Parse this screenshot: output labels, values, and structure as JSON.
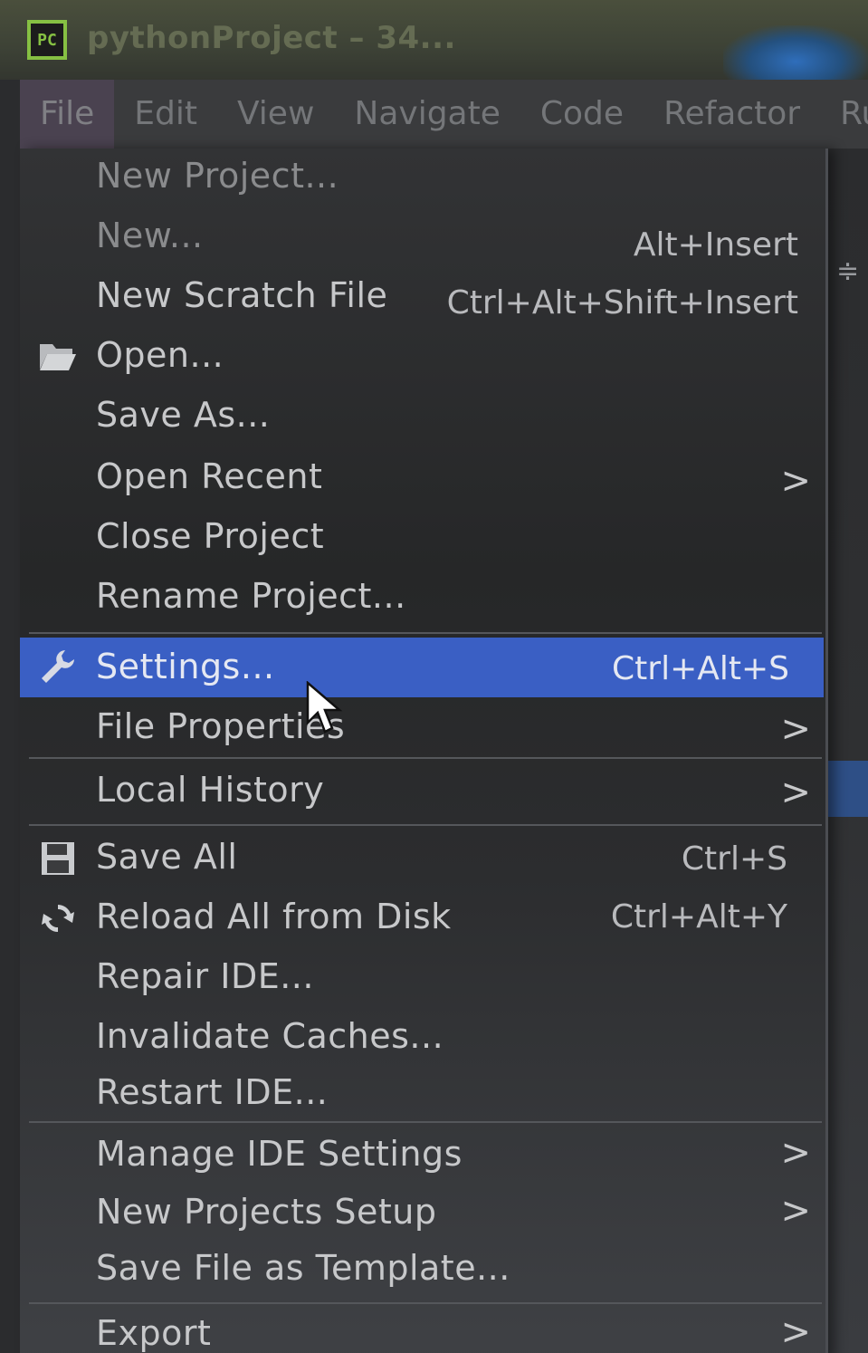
{
  "window": {
    "app_icon_text": "PC",
    "title": "pythonProject – 34..."
  },
  "menubar": {
    "items": [
      {
        "label": "File",
        "active": true
      },
      {
        "label": "Edit"
      },
      {
        "label": "View"
      },
      {
        "label": "Navigate"
      },
      {
        "label": "Code"
      },
      {
        "label": "Refactor"
      },
      {
        "label": "Run"
      }
    ]
  },
  "file_menu": {
    "items": [
      {
        "label": "New Project...",
        "shortcut": "",
        "submenu": false,
        "icon": "",
        "dim": true
      },
      {
        "label": "New...",
        "shortcut": "Alt+Insert",
        "submenu": false,
        "icon": "",
        "dim": true
      },
      {
        "label": "New Scratch File",
        "shortcut": "Ctrl+Alt+Shift+Insert",
        "submenu": false,
        "icon": ""
      },
      {
        "label": "Open...",
        "shortcut": "",
        "submenu": false,
        "icon": "folder-open-icon"
      },
      {
        "label": "Save As...",
        "shortcut": "",
        "submenu": false,
        "icon": ""
      },
      {
        "label": "Open Recent",
        "shortcut": "",
        "submenu": true,
        "icon": ""
      },
      {
        "label": "Close Project",
        "shortcut": "",
        "submenu": false,
        "icon": ""
      },
      {
        "label": "Rename Project...",
        "shortcut": "",
        "submenu": false,
        "icon": ""
      },
      {
        "label": "Settings...",
        "shortcut": "Ctrl+Alt+S",
        "submenu": false,
        "icon": "wrench-icon",
        "selected": true
      },
      {
        "label": "File Properties",
        "shortcut": "",
        "submenu": true,
        "icon": ""
      },
      {
        "label": "Local History",
        "shortcut": "",
        "submenu": true,
        "icon": ""
      },
      {
        "label": "Save All",
        "shortcut": "Ctrl+S",
        "submenu": false,
        "icon": "save-icon"
      },
      {
        "label": "Reload All from Disk",
        "shortcut": "Ctrl+Alt+Y",
        "submenu": false,
        "icon": "reload-icon"
      },
      {
        "label": "Repair IDE...",
        "shortcut": "",
        "submenu": false,
        "icon": ""
      },
      {
        "label": "Invalidate Caches...",
        "shortcut": "",
        "submenu": false,
        "icon": ""
      },
      {
        "label": "Restart IDE...",
        "shortcut": "",
        "submenu": false,
        "icon": ""
      },
      {
        "label": "Manage IDE Settings",
        "shortcut": "",
        "submenu": true,
        "icon": ""
      },
      {
        "label": "New Projects Setup",
        "shortcut": "",
        "submenu": true,
        "icon": ""
      },
      {
        "label": "Save File as Template...",
        "shortcut": "",
        "submenu": false,
        "icon": ""
      },
      {
        "label": "Export",
        "shortcut": "",
        "submenu": true,
        "icon": ""
      }
    ],
    "submenu_arrow": ">"
  },
  "colors": {
    "selection": "#3a5fc4",
    "menu_bg": "#2b2c2e",
    "text": "#c7c8ca",
    "app_icon_border": "#86c043"
  }
}
